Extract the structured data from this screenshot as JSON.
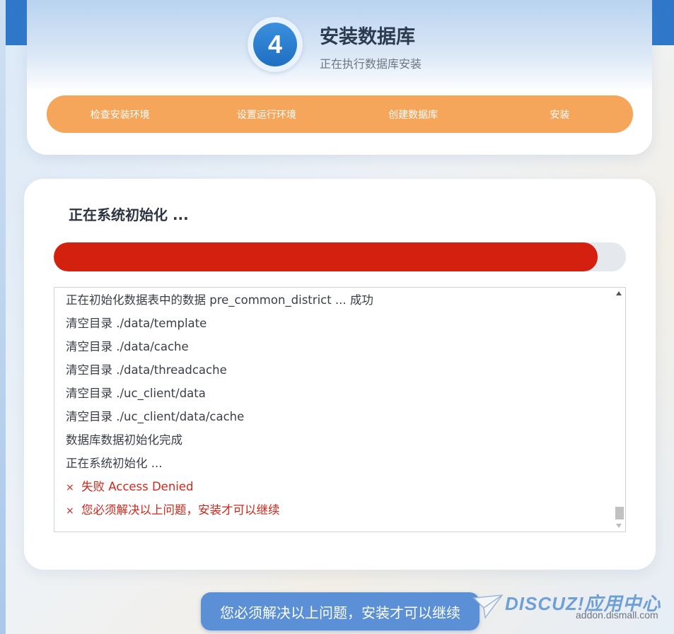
{
  "header": {
    "step_number": "4",
    "title": "安装数据库",
    "subtitle": "正在执行数据库安装",
    "steps": [
      "检查安装环境",
      "设置运行环境",
      "创建数据库",
      "安装"
    ]
  },
  "main": {
    "title": "正在系统初始化 ...",
    "progress_fraction": 0.951,
    "log": [
      {
        "text": "正在初始化数据表中的数据 pre_common_district ... 成功",
        "error": false
      },
      {
        "text": "清空目录 ./data/template",
        "error": false
      },
      {
        "text": "清空目录 ./data/cache",
        "error": false
      },
      {
        "text": "清空目录 ./data/threadcache",
        "error": false
      },
      {
        "text": "清空目录 ./uc_client/data",
        "error": false
      },
      {
        "text": "清空目录 ./uc_client/data/cache",
        "error": false
      },
      {
        "text": "数据库数据初始化完成",
        "error": false
      },
      {
        "text": "正在系统初始化 ...",
        "error": false
      },
      {
        "mark": "×",
        "text": "失败 Access Denied",
        "error": true
      },
      {
        "mark": "×",
        "text": "您必须解决以上问题，安装才可以继续",
        "error": true
      }
    ]
  },
  "toast": {
    "text": "您必须解决以上问题，安装才可以继续"
  },
  "watermark": {
    "logo": "DISCUZ!应用中心",
    "site": "addon.dismall.com"
  },
  "colors": {
    "accent_orange": "#f5a65b",
    "progress_red": "#d4200f",
    "error_red": "#d0281c",
    "brand_blue": "#2f77c9",
    "toast_blue": "#5b8fd6"
  }
}
